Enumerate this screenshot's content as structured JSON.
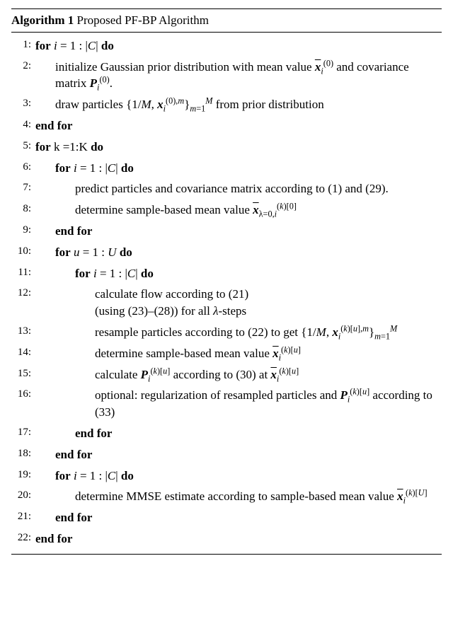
{
  "algorithm": {
    "number": "1",
    "title_prefix": "Algorithm",
    "title_rest": "Proposed PF-BP Algorithm",
    "lines": [
      {
        "n": "1:",
        "indent": 0,
        "html": "<span class='kw'>for</span> <span class='mi'>i</span> = 1 : |<span class='cal'>C</span>| <span class='kw'>do</span>"
      },
      {
        "n": "2:",
        "indent": 1,
        "html": "initialize Gaussian prior distribution with mean value <span class='nowrap'><span class='bi ovl'>x</span><span class='sub'><span class='mi'>i</span></span><span class='sup'>(0)</span></span> and covariance matrix <span class='nowrap'><span class='bi'>P</span><span class='sub'><span class='mi'>i</span></span><span class='sup'>(0)</span></span>."
      },
      {
        "n": "3:",
        "indent": 1,
        "html": "draw particles <span class='nowrap'>{1/<span class='mi'>M</span>, <span class='bi'>x</span><span class='sub'><span class='mi'>i</span></span><span class='sup'>(0),<span class='mi'>m</span></span>}<span class='sub'><span class='mi'>m</span>=1</span><span class='sup'><span class='mi'>M</span></span></span> from prior distribution"
      },
      {
        "n": "4:",
        "indent": 0,
        "html": "<span class='kw'>end for</span>"
      },
      {
        "n": "5:",
        "indent": 0,
        "html": "<span class='kw'>for</span> k =1:K <span class='kw'>do</span>"
      },
      {
        "n": "6:",
        "indent": 1,
        "html": "<span class='kw'>for</span> <span class='mi'>i</span> = 1 : |<span class='cal'>C</span>| <span class='kw'>do</span>"
      },
      {
        "n": "7:",
        "indent": 2,
        "html": "predict particles and covariance matrix according to (1) and (29)."
      },
      {
        "n": "8:",
        "indent": 2,
        "html": "determine sample-based mean value <span class='nowrap'><span class='bi ovl'>x</span><span class='sub'>&lambda;=0,<span class='mi'>i</span></span><span class='sup'>(<span class='mi'>k</span>)[0]</span></span>"
      },
      {
        "n": "9:",
        "indent": 1,
        "html": "<span class='kw'>end for</span>"
      },
      {
        "n": "10:",
        "indent": 1,
        "html": "<span class='kw'>for</span> <span class='mi'>u</span> = 1 : <span class='mi'>U</span> <span class='kw'>do</span>"
      },
      {
        "n": "11:",
        "indent": 2,
        "html": "<span class='kw'>for</span> <span class='mi'>i</span> = 1 : |<span class='cal'>C</span>| <span class='kw'>do</span>"
      },
      {
        "n": "12:",
        "indent": 3,
        "html": "calculate flow according to (21)<br>(using (23)&ndash;(28)) for all <span class='mi'>&lambda;</span>-steps"
      },
      {
        "n": "13:",
        "indent": 3,
        "html": "resample particles according to (22) to get <span class='nowrap'>{1/<span class='mi'>M</span>, <span class='bi'>x</span><span class='sub'><span class='mi'>i</span></span><span class='sup'>(<span class='mi'>k</span>)[<span class='mi'>u</span>],<span class='mi'>m</span></span>}<span class='sub'><span class='mi'>m</span>=1</span><span class='sup'><span class='mi'>M</span></span></span>"
      },
      {
        "n": "14:",
        "indent": 3,
        "html": "determine sample-based mean value <span class='nowrap'><span class='bi ovl'>x</span><span class='sub'><span class='mi'>i</span></span><span class='sup'>(<span class='mi'>k</span>)[<span class='mi'>u</span>]</span></span>"
      },
      {
        "n": "15:",
        "indent": 3,
        "html": "calculate <span class='nowrap'><span class='bi'>P</span><span class='sub'><span class='mi'>i</span></span><span class='sup'>(<span class='mi'>k</span>)[<span class='mi'>u</span>]</span></span> according to (30) at <span class='nowrap'><span class='bi ovl'>x</span><span class='sub'><span class='mi'>i</span></span><span class='sup'>(<span class='mi'>k</span>)[<span class='mi'>u</span>]</span></span>"
      },
      {
        "n": "16:",
        "indent": 3,
        "html": "optional: regularization of resampled particles and <span class='nowrap'><span class='bi'>P</span><span class='sub'><span class='mi'>i</span></span><span class='sup'>(<span class='mi'>k</span>)[<span class='mi'>u</span>]</span></span> according to (33)"
      },
      {
        "n": "17:",
        "indent": 2,
        "html": "<span class='kw'>end for</span>"
      },
      {
        "n": "18:",
        "indent": 1,
        "html": "<span class='kw'>end for</span>"
      },
      {
        "n": "19:",
        "indent": 1,
        "html": "<span class='kw'>for</span> <span class='mi'>i</span> = 1 : |<span class='cal'>C</span>| <span class='kw'>do</span>"
      },
      {
        "n": "20:",
        "indent": 2,
        "html": "determine MMSE estimate according to sample-based mean value <span class='nowrap'><span class='bi ovl'>x</span><span class='sub'><span class='mi'>i</span></span><span class='sup'>(<span class='mi'>k</span>)[<span class='mi'>U</span>]</span></span>"
      },
      {
        "n": "21:",
        "indent": 1,
        "html": "<span class='kw'>end for</span>"
      },
      {
        "n": "22:",
        "indent": 0,
        "html": "<span class='kw'>end for</span>"
      }
    ]
  }
}
